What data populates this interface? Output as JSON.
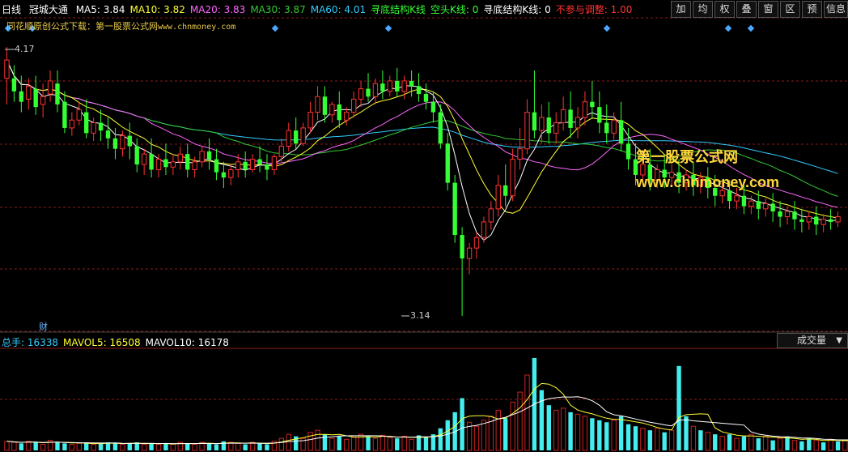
{
  "header": {
    "period": "日线",
    "stock_name": "冠城大通",
    "indicators": [
      {
        "text": "MA5: 3.84",
        "color": "#ffffff"
      },
      {
        "text": "MA10: 3.82",
        "color": "#ffff33"
      },
      {
        "text": "MA20: 3.83",
        "color": "#ff66ff"
      },
      {
        "text": "MA30: 3.87",
        "color": "#33cc33"
      },
      {
        "text": "MA60: 4.01",
        "color": "#33ccff"
      },
      {
        "text": "寻底结构K线",
        "color": "#33ff33"
      },
      {
        "text": "空头K线: 0",
        "color": "#33ff33"
      },
      {
        "text": "寻底结构K线: 0",
        "color": "#ffffff"
      },
      {
        "text": "不参与调整: 1.00",
        "color": "#ff3333"
      }
    ]
  },
  "toolbar": [
    "加",
    "均",
    "权",
    "叠",
    "窗",
    "区",
    "预",
    "信息"
  ],
  "subtitle": {
    "text": "同花顺原创公式下载：第一股票公式网",
    "url": "www.chnmoney.com"
  },
  "watermark": {
    "line1": "第一股票公式网",
    "line2": "www.chnmoney.com"
  },
  "price_labels": {
    "high": "4.17",
    "low": "3.14",
    "cai": "财"
  },
  "volume_header": {
    "items": [
      {
        "text": "总手: 16338",
        "color": "#33ccff"
      },
      {
        "text": "MAVOL5: 16508",
        "color": "#ffff33"
      },
      {
        "text": "MAVOL10: 16178",
        "color": "#ffffff"
      }
    ],
    "dropdown": "成交量"
  },
  "colors": {
    "up": "#ff3333",
    "down": "#33ff33",
    "vol_up": "#cc2222",
    "vol_down": "#44eeee",
    "grid": "#8a1a1a"
  },
  "chart_data": {
    "type": "candlestick",
    "price_range": [
      3.14,
      4.17
    ],
    "candles": [
      [
        4.05,
        4.17,
        4.12,
        3.95
      ],
      [
        4.05,
        4.1,
        4.0,
        3.96
      ],
      [
        4.0,
        4.06,
        3.96,
        3.92
      ],
      [
        3.97,
        4.05,
        4.02,
        3.93
      ],
      [
        4.01,
        4.06,
        3.94,
        3.91
      ],
      [
        3.95,
        4.03,
        3.98,
        3.9
      ],
      [
        3.99,
        4.08,
        4.04,
        3.96
      ],
      [
        4.03,
        4.08,
        3.95,
        3.92
      ],
      [
        3.96,
        4.0,
        3.86,
        3.84
      ],
      [
        3.86,
        3.92,
        3.89,
        3.83
      ],
      [
        3.89,
        3.96,
        3.93,
        3.87
      ],
      [
        3.92,
        3.97,
        3.84,
        3.82
      ],
      [
        3.84,
        3.9,
        3.88,
        3.81
      ],
      [
        3.88,
        3.93,
        3.85,
        3.81
      ],
      [
        3.85,
        3.9,
        3.82,
        3.78
      ],
      [
        3.82,
        3.86,
        3.78,
        3.74
      ],
      [
        3.78,
        3.85,
        3.83,
        3.75
      ],
      [
        3.83,
        3.88,
        3.79,
        3.74
      ],
      [
        3.79,
        3.82,
        3.72,
        3.69
      ],
      [
        3.72,
        3.78,
        3.76,
        3.68
      ],
      [
        3.76,
        3.82,
        3.7,
        3.67
      ],
      [
        3.7,
        3.76,
        3.74,
        3.67
      ],
      [
        3.74,
        3.8,
        3.71,
        3.68
      ],
      [
        3.71,
        3.76,
        3.73,
        3.68
      ],
      [
        3.73,
        3.79,
        3.76,
        3.7
      ],
      [
        3.76,
        3.8,
        3.7,
        3.67
      ],
      [
        3.7,
        3.75,
        3.73,
        3.67
      ],
      [
        3.73,
        3.79,
        3.77,
        3.71
      ],
      [
        3.77,
        3.82,
        3.74,
        3.7
      ],
      [
        3.74,
        3.78,
        3.69,
        3.66
      ],
      [
        3.69,
        3.73,
        3.67,
        3.63
      ],
      [
        3.67,
        3.72,
        3.7,
        3.64
      ],
      [
        3.7,
        3.76,
        3.73,
        3.67
      ],
      [
        3.73,
        3.77,
        3.7,
        3.67
      ],
      [
        3.7,
        3.76,
        3.74,
        3.69
      ],
      [
        3.74,
        3.79,
        3.72,
        3.69
      ],
      [
        3.72,
        3.76,
        3.7,
        3.66
      ],
      [
        3.7,
        3.76,
        3.75,
        3.68
      ],
      [
        3.75,
        3.82,
        3.79,
        3.73
      ],
      [
        3.79,
        3.88,
        3.85,
        3.77
      ],
      [
        3.85,
        3.9,
        3.8,
        3.78
      ],
      [
        3.8,
        3.88,
        3.86,
        3.79
      ],
      [
        3.86,
        3.96,
        3.92,
        3.84
      ],
      [
        3.92,
        4.02,
        3.98,
        3.89
      ],
      [
        3.98,
        4.02,
        3.91,
        3.88
      ],
      [
        3.91,
        3.96,
        3.95,
        3.88
      ],
      [
        3.95,
        4.0,
        3.89,
        3.86
      ],
      [
        3.89,
        3.94,
        3.92,
        3.87
      ],
      [
        3.92,
        4.0,
        3.97,
        3.9
      ],
      [
        3.97,
        4.04,
        4.01,
        3.94
      ],
      [
        4.01,
        4.07,
        3.98,
        3.96
      ],
      [
        3.98,
        4.05,
        4.03,
        3.95
      ],
      [
        4.03,
        4.08,
        4.0,
        3.97
      ],
      [
        4.0,
        4.06,
        4.04,
        3.98
      ],
      [
        4.04,
        4.09,
        4.0,
        3.98
      ],
      [
        4.0,
        4.06,
        4.04,
        3.97
      ],
      [
        4.04,
        4.08,
        4.02,
        3.98
      ],
      [
        4.02,
        4.07,
        3.99,
        3.96
      ],
      [
        3.99,
        4.03,
        3.96,
        3.93
      ],
      [
        3.96,
        4.0,
        3.92,
        3.88
      ],
      [
        3.92,
        3.95,
        3.8,
        3.78
      ],
      [
        3.8,
        3.84,
        3.65,
        3.62
      ],
      [
        3.65,
        3.68,
        3.45,
        3.42
      ],
      [
        3.45,
        3.48,
        3.36,
        3.14
      ],
      [
        3.36,
        3.42,
        3.4,
        3.3
      ],
      [
        3.4,
        3.46,
        3.44,
        3.36
      ],
      [
        3.44,
        3.52,
        3.5,
        3.42
      ],
      [
        3.5,
        3.58,
        3.55,
        3.47
      ],
      [
        3.55,
        3.68,
        3.64,
        3.52
      ],
      [
        3.64,
        3.72,
        3.6,
        3.56
      ],
      [
        3.6,
        3.78,
        3.74,
        3.58
      ],
      [
        3.74,
        3.86,
        3.78,
        3.7
      ],
      [
        3.78,
        3.97,
        3.92,
        3.76
      ],
      [
        3.92,
        4.08,
        3.85,
        3.82
      ],
      [
        3.85,
        3.95,
        3.9,
        3.8
      ],
      [
        3.9,
        3.96,
        3.84,
        3.8
      ],
      [
        3.84,
        3.92,
        3.88,
        3.8
      ],
      [
        3.88,
        3.98,
        3.93,
        3.85
      ],
      [
        3.93,
        4.0,
        3.86,
        3.82
      ],
      [
        3.86,
        3.94,
        3.9,
        3.82
      ],
      [
        3.9,
        4.0,
        3.96,
        3.87
      ],
      [
        3.96,
        4.04,
        3.94,
        3.9
      ],
      [
        3.94,
        4.0,
        3.88,
        3.84
      ],
      [
        3.88,
        3.95,
        3.84,
        3.8
      ],
      [
        3.84,
        3.92,
        3.89,
        3.81
      ],
      [
        3.89,
        3.96,
        3.8,
        3.77
      ],
      [
        3.8,
        3.86,
        3.74,
        3.7
      ],
      [
        3.74,
        3.8,
        3.68,
        3.64
      ],
      [
        3.68,
        3.74,
        3.72,
        3.64
      ],
      [
        3.72,
        3.78,
        3.66,
        3.62
      ],
      [
        3.66,
        3.72,
        3.7,
        3.63
      ],
      [
        3.7,
        3.76,
        3.67,
        3.63
      ],
      [
        3.67,
        3.72,
        3.69,
        3.64
      ],
      [
        3.69,
        3.74,
        3.65,
        3.61
      ],
      [
        3.65,
        3.7,
        3.68,
        3.62
      ],
      [
        3.68,
        3.73,
        3.64,
        3.6
      ],
      [
        3.64,
        3.69,
        3.67,
        3.61
      ],
      [
        3.67,
        3.71,
        3.63,
        3.59
      ],
      [
        3.63,
        3.68,
        3.6,
        3.56
      ],
      [
        3.6,
        3.65,
        3.62,
        3.57
      ],
      [
        3.62,
        3.66,
        3.58,
        3.55
      ],
      [
        3.58,
        3.63,
        3.6,
        3.55
      ],
      [
        3.6,
        3.64,
        3.56,
        3.53
      ],
      [
        3.56,
        3.6,
        3.58,
        3.53
      ],
      [
        3.58,
        3.62,
        3.55,
        3.51
      ],
      [
        3.55,
        3.59,
        3.57,
        3.52
      ],
      [
        3.57,
        3.61,
        3.54,
        3.5
      ],
      [
        3.54,
        3.58,
        3.52,
        3.48
      ],
      [
        3.52,
        3.56,
        3.54,
        3.49
      ],
      [
        3.54,
        3.58,
        3.51,
        3.47
      ],
      [
        3.51,
        3.55,
        3.5,
        3.46
      ],
      [
        3.5,
        3.54,
        3.52,
        3.47
      ],
      [
        3.52,
        3.56,
        3.49,
        3.45
      ],
      [
        3.49,
        3.53,
        3.51,
        3.46
      ],
      [
        3.51,
        3.55,
        3.5,
        3.47
      ],
      [
        3.5,
        3.54,
        3.52,
        3.48
      ]
    ],
    "volumes": [
      [
        9,
        1
      ],
      [
        8,
        1
      ],
      [
        7,
        0
      ],
      [
        9,
        1
      ],
      [
        8,
        0
      ],
      [
        6,
        1
      ],
      [
        10,
        1
      ],
      [
        8,
        0
      ],
      [
        7,
        0
      ],
      [
        6,
        1
      ],
      [
        7,
        1
      ],
      [
        8,
        0
      ],
      [
        6,
        1
      ],
      [
        7,
        0
      ],
      [
        8,
        0
      ],
      [
        7,
        0
      ],
      [
        6,
        1
      ],
      [
        7,
        0
      ],
      [
        8,
        0
      ],
      [
        6,
        1
      ],
      [
        7,
        0
      ],
      [
        6,
        1
      ],
      [
        7,
        0
      ],
      [
        6,
        1
      ],
      [
        8,
        1
      ],
      [
        7,
        0
      ],
      [
        6,
        1
      ],
      [
        8,
        1
      ],
      [
        7,
        0
      ],
      [
        6,
        0
      ],
      [
        9,
        0
      ],
      [
        8,
        1
      ],
      [
        7,
        1
      ],
      [
        6,
        0
      ],
      [
        8,
        1
      ],
      [
        7,
        0
      ],
      [
        6,
        0
      ],
      [
        9,
        1
      ],
      [
        12,
        1
      ],
      [
        16,
        1
      ],
      [
        14,
        0
      ],
      [
        12,
        1
      ],
      [
        18,
        1
      ],
      [
        20,
        1
      ],
      [
        16,
        0
      ],
      [
        12,
        1
      ],
      [
        14,
        0
      ],
      [
        11,
        1
      ],
      [
        13,
        1
      ],
      [
        16,
        1
      ],
      [
        14,
        0
      ],
      [
        12,
        1
      ],
      [
        15,
        1
      ],
      [
        13,
        1
      ],
      [
        12,
        0
      ],
      [
        14,
        1
      ],
      [
        11,
        1
      ],
      [
        15,
        0
      ],
      [
        13,
        0
      ],
      [
        16,
        0
      ],
      [
        22,
        0
      ],
      [
        30,
        0
      ],
      [
        38,
        0
      ],
      [
        52,
        0
      ],
      [
        28,
        1
      ],
      [
        24,
        1
      ],
      [
        30,
        1
      ],
      [
        34,
        1
      ],
      [
        40,
        1
      ],
      [
        32,
        0
      ],
      [
        48,
        1
      ],
      [
        58,
        1
      ],
      [
        75,
        1
      ],
      [
        92,
        0
      ],
      [
        60,
        0
      ],
      [
        45,
        0
      ],
      [
        40,
        1
      ],
      [
        42,
        1
      ],
      [
        38,
        0
      ],
      [
        36,
        1
      ],
      [
        34,
        1
      ],
      [
        32,
        0
      ],
      [
        30,
        0
      ],
      [
        28,
        0
      ],
      [
        30,
        1
      ],
      [
        34,
        0
      ],
      [
        26,
        0
      ],
      [
        24,
        0
      ],
      [
        22,
        1
      ],
      [
        20,
        0
      ],
      [
        22,
        1
      ],
      [
        18,
        0
      ],
      [
        20,
        1
      ],
      [
        84,
        0
      ],
      [
        34,
        0
      ],
      [
        24,
        1
      ],
      [
        20,
        0
      ],
      [
        18,
        1
      ],
      [
        16,
        0
      ],
      [
        14,
        1
      ],
      [
        16,
        0
      ],
      [
        12,
        1
      ],
      [
        14,
        0
      ],
      [
        16,
        1
      ],
      [
        12,
        0
      ],
      [
        14,
        1
      ],
      [
        10,
        0
      ],
      [
        12,
        1
      ],
      [
        14,
        0
      ],
      [
        10,
        1
      ],
      [
        9,
        0
      ],
      [
        12,
        0
      ],
      [
        10,
        1
      ],
      [
        8,
        0
      ],
      [
        11,
        1
      ],
      [
        9,
        0
      ],
      [
        10,
        1
      ],
      [
        12,
        0
      ]
    ]
  }
}
